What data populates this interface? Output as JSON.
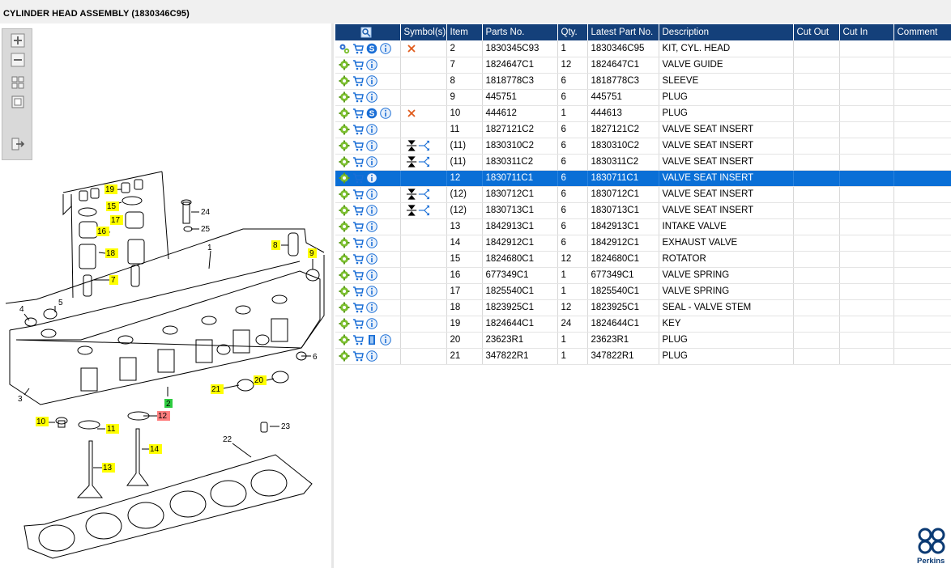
{
  "header": {
    "title": "CYLINDER HEAD ASSEMBLY (1830346C95)"
  },
  "colors": {
    "header_bg": "#14407a",
    "selected_row": "#0a6fd6",
    "callout_yellow": "#ffff00",
    "callout_green": "#2ecc40",
    "callout_red": "#ff7f7f"
  },
  "toolbar": {
    "icons": [
      "zoom-in-icon",
      "zoom-out-icon",
      "fit-all-icon",
      "actual-size-icon",
      "export-icon"
    ]
  },
  "table": {
    "columns": [
      "",
      "Symbol(s)",
      "Item",
      "Parts No.",
      "Qty.",
      "Latest Part No.",
      "Description",
      "Cut Out",
      "Cut In",
      "Comment"
    ],
    "rows": [
      {
        "item": "2",
        "part": "1830345C93",
        "qty": "1",
        "latest": "1830346C95",
        "desc": "KIT, CYL. HEAD"
      },
      {
        "item": "7",
        "part": "1824647C1",
        "qty": "12",
        "latest": "1824647C1",
        "desc": "VALVE GUIDE"
      },
      {
        "item": "8",
        "part": "1818778C3",
        "qty": "6",
        "latest": "1818778C3",
        "desc": "SLEEVE"
      },
      {
        "item": "9",
        "part": "445751",
        "qty": "6",
        "latest": "445751",
        "desc": "PLUG"
      },
      {
        "item": "10",
        "part": "444612",
        "qty": "1",
        "latest": "444613",
        "desc": "PLUG"
      },
      {
        "item": "11",
        "part": "1827121C2",
        "qty": "6",
        "latest": "1827121C2",
        "desc": "VALVE SEAT INSERT"
      },
      {
        "item": "(11)",
        "part": "1830310C2",
        "qty": "6",
        "latest": "1830310C2",
        "desc": "VALVE SEAT INSERT"
      },
      {
        "item": "(11)",
        "part": "1830311C2",
        "qty": "6",
        "latest": "1830311C2",
        "desc": "VALVE SEAT INSERT"
      },
      {
        "item": "12",
        "part": "1830711C1",
        "qty": "6",
        "latest": "1830711C1",
        "desc": "VALVE SEAT INSERT"
      },
      {
        "item": "(12)",
        "part": "1830712C1",
        "qty": "6",
        "latest": "1830712C1",
        "desc": "VALVE SEAT INSERT"
      },
      {
        "item": "(12)",
        "part": "1830713C1",
        "qty": "6",
        "latest": "1830713C1",
        "desc": "VALVE SEAT INSERT"
      },
      {
        "item": "13",
        "part": "1842913C1",
        "qty": "6",
        "latest": "1842913C1",
        "desc": "INTAKE VALVE"
      },
      {
        "item": "14",
        "part": "1842912C1",
        "qty": "6",
        "latest": "1842912C1",
        "desc": "EXHAUST VALVE"
      },
      {
        "item": "15",
        "part": "1824680C1",
        "qty": "12",
        "latest": "1824680C1",
        "desc": "ROTATOR"
      },
      {
        "item": "16",
        "part": "677349C1",
        "qty": "1",
        "latest": "677349C1",
        "desc": "VALVE SPRING"
      },
      {
        "item": "17",
        "part": "1825540C1",
        "qty": "1",
        "latest": "1825540C1",
        "desc": "VALVE SPRING"
      },
      {
        "item": "18",
        "part": "1823925C1",
        "qty": "12",
        "latest": "1823925C1",
        "desc": "SEAL - VALVE STEM"
      },
      {
        "item": "19",
        "part": "1824644C1",
        "qty": "24",
        "latest": "1824644C1",
        "desc": "KEY"
      },
      {
        "item": "20",
        "part": "23623R1",
        "qty": "1",
        "latest": "23623R1",
        "desc": "PLUG"
      },
      {
        "item": "21",
        "part": "347822R1",
        "qty": "1",
        "latest": "347822R1",
        "desc": "PLUG"
      }
    ]
  },
  "diagram": {
    "callouts": [
      "1",
      "2",
      "3",
      "4",
      "5",
      "6",
      "7",
      "8",
      "9",
      "10",
      "11",
      "12",
      "13",
      "14",
      "15",
      "16",
      "17",
      "18",
      "19",
      "20",
      "21",
      "22",
      "23",
      "24",
      "25"
    ]
  },
  "brand": {
    "logo_text": "Perkins"
  }
}
